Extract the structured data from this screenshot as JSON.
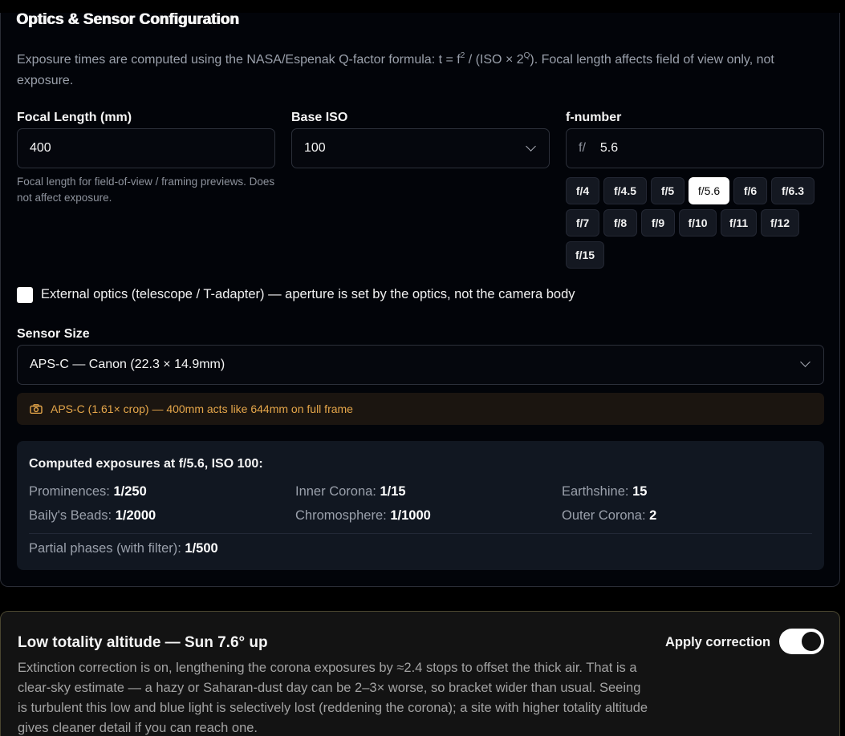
{
  "optics": {
    "title": "Optics & Sensor Configuration",
    "description_pre": "Exposure times are computed using the NASA/Espenak Q-factor formula: t = f",
    "description_sup1": "2",
    "description_mid": " / (ISO × 2",
    "description_sup2": "Q",
    "description_post": "). Focal length affects field of view only, not exposure.",
    "focal_length": {
      "label": "Focal Length (mm)",
      "value": "400",
      "hint": "Focal length for field-of-view / framing previews. Does not affect exposure."
    },
    "base_iso": {
      "label": "Base ISO",
      "value": "100"
    },
    "f_number": {
      "label": "f-number",
      "prefix": "f/",
      "value": "5.6",
      "presets": [
        "f/4",
        "f/4.5",
        "f/5",
        "f/5.6",
        "f/6",
        "f/6.3",
        "f/7",
        "f/8",
        "f/9",
        "f/10",
        "f/11",
        "f/12",
        "f/15"
      ],
      "selected": "f/5.6"
    },
    "external_optics": {
      "label": "External optics (telescope / T-adapter) — aperture is set by the optics, not the camera body",
      "checked": false
    },
    "sensor_size": {
      "label": "Sensor Size",
      "value": "APS-C — Canon (22.3 × 14.9mm)"
    },
    "crop_note": {
      "icon": "camera-icon",
      "text": "APS-C (1.61× crop) — 400mm acts like 644mm on full frame",
      "color": "#e5a64a"
    },
    "computed": {
      "title": "Computed exposures at f/5.6, ISO 100:",
      "items": [
        {
          "label": "Prominences:",
          "value": "1/250"
        },
        {
          "label": "Inner Corona:",
          "value": "1/15"
        },
        {
          "label": "Earthshine:",
          "value": "15"
        },
        {
          "label": "Baily's Beads:",
          "value": "1/2000"
        },
        {
          "label": "Chromosphere:",
          "value": "1/1000"
        },
        {
          "label": "Outer Corona:",
          "value": "2"
        }
      ],
      "partial": {
        "label": "Partial phases (with filter):",
        "value": "1/500"
      }
    }
  },
  "altitude_warning": {
    "title": "Low totality altitude — Sun 7.6° up",
    "text": "Extinction correction is on, lengthening the corona exposures by ≈2.4 stops to offset the thick air. That is a clear-sky estimate — a hazy or Saharan-dust day can be 2–3× worse, so bracket wider than usual. Seeing is turbulent this low and blue light is selectively lost (reddening the corona); a site with higher totality altitude gives cleaner detail if you can reach one.",
    "toggle_label": "Apply correction",
    "toggle_on": true
  }
}
